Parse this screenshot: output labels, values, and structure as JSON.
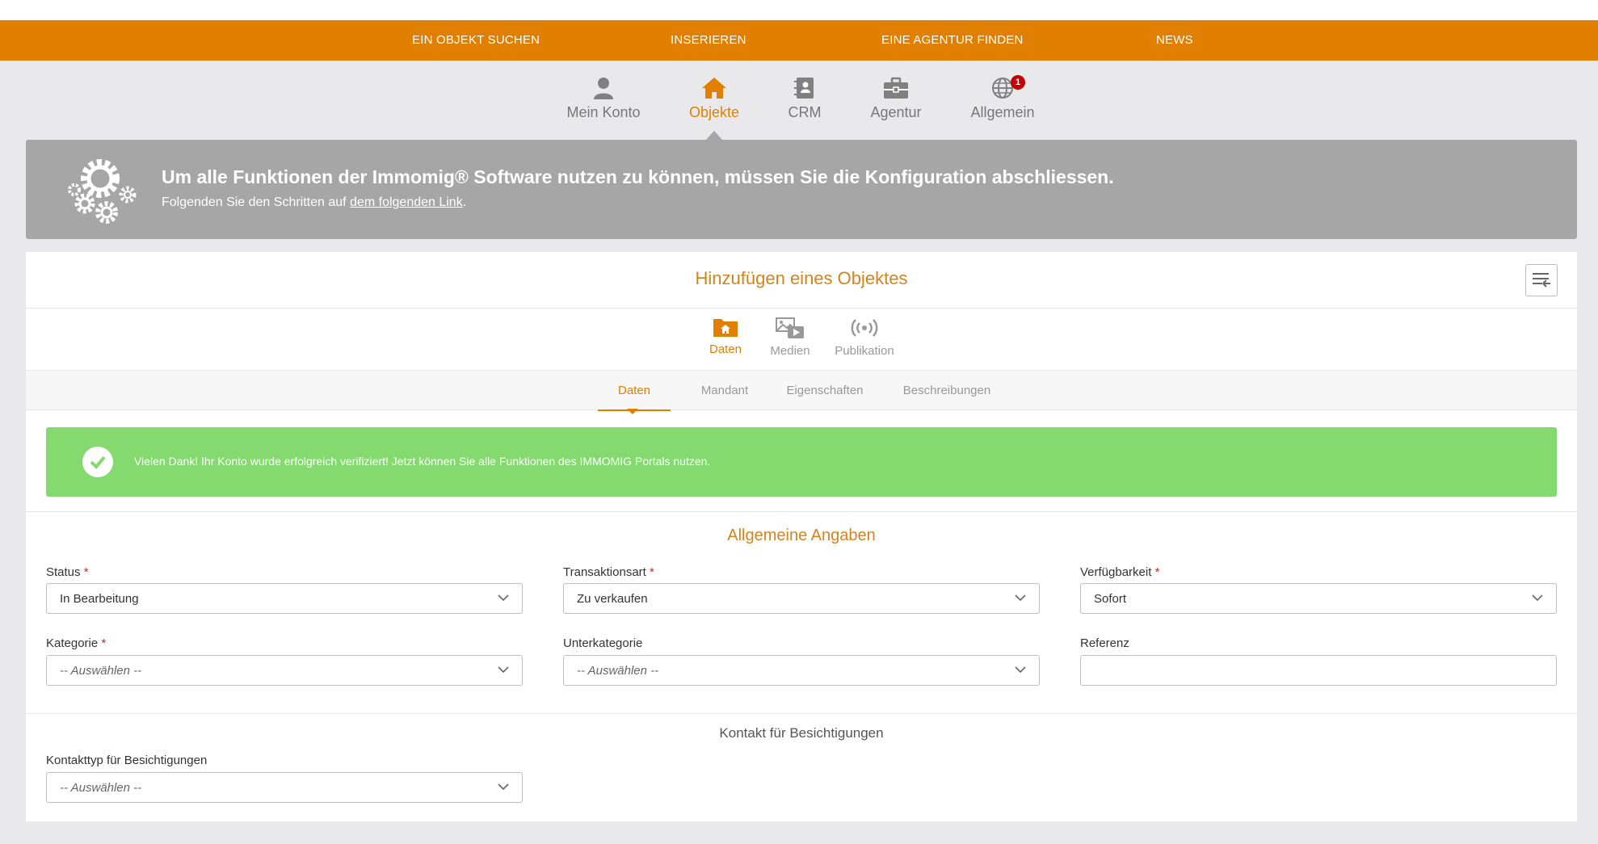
{
  "topnav": {
    "items": [
      "EIN OBJEKT SUCHEN",
      "INSERIEREN",
      "EINE AGENTUR FINDEN",
      "NEWS"
    ]
  },
  "mainnav": {
    "items": [
      {
        "label": "Mein Konto",
        "icon": "user-icon"
      },
      {
        "label": "Objekte",
        "icon": "home-icon",
        "active": true
      },
      {
        "label": "CRM",
        "icon": "address-book-icon"
      },
      {
        "label": "Agentur",
        "icon": "briefcase-icon"
      },
      {
        "label": "Allgemein",
        "icon": "globe-icon",
        "badge": "1"
      }
    ]
  },
  "banner": {
    "title": "Um alle Funktionen der Immomig® Software nutzen zu können, müssen Sie die Konfiguration abschliessen.",
    "subtitle_prefix": "Folgenden Sie den Schritten auf ",
    "subtitle_link": "dem folgenden Link",
    "subtitle_suffix": "."
  },
  "card": {
    "title": "Hinzufügen eines Objektes",
    "subnav": [
      {
        "label": "Daten",
        "icon": "folder-home-icon",
        "active": true
      },
      {
        "label": "Medien",
        "icon": "media-icon"
      },
      {
        "label": "Publikation",
        "icon": "broadcast-icon"
      }
    ],
    "tabs": [
      {
        "label": "Daten",
        "active": true
      },
      {
        "label": "Mandant"
      },
      {
        "label": "Eigenschaften"
      },
      {
        "label": "Beschreibungen"
      }
    ],
    "alert": "Vielen Dank! Ihr Konto wurde erfolgreich verifiziert! Jetzt können Sie alle Funktionen des IMMOMIG Portals nutzen."
  },
  "general": {
    "title": "Allgemeine Angaben",
    "status": {
      "label": "Status",
      "value": "In Bearbeitung"
    },
    "transaktionsart": {
      "label": "Transaktionsart",
      "value": "Zu verkaufen"
    },
    "verfuegbarkeit": {
      "label": "Verfügbarkeit",
      "value": "Sofort"
    },
    "kategorie": {
      "label": "Kategorie",
      "placeholder": "-- Auswählen --"
    },
    "unterkategorie": {
      "label": "Unterkategorie",
      "placeholder": "-- Auswählen --"
    },
    "referenz": {
      "label": "Referenz",
      "value": ""
    }
  },
  "contact": {
    "title": "Kontakt für Besichtigungen",
    "kontakttyp": {
      "label": "Kontakttyp für Besichtigungen",
      "placeholder": "-- Auswählen --"
    }
  },
  "colors": {
    "accent": "#e17f00",
    "banner": "#a6a6a6",
    "success": "#84da6f",
    "required": "#c62828"
  }
}
